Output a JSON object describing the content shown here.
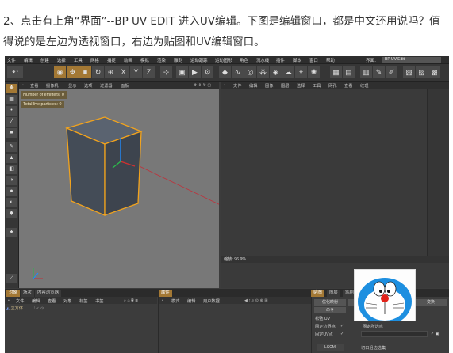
{
  "intro": {
    "line1": "2、点击有上角“界面”--BP UV EDIT 进入UV编辑。下图是编辑窗口，都是中文还用说吗？值",
    "line2": "得说的是左边为透视窗口，右边为贴图和UV编辑窗口。"
  },
  "app": {
    "menu": [
      "文件",
      "编辑",
      "创建",
      "选择",
      "工具",
      "网格",
      "捕捉",
      "动画",
      "模拟",
      "渲染",
      "雕刻",
      "运动跟踪",
      "运动图形",
      "角色",
      "流水线",
      "插件",
      "脚本",
      "窗口",
      "帮助"
    ],
    "layout_label": "界面：",
    "layout_value": "BP UV Edit",
    "viewport": {
      "menu": [
        "查看",
        "摄像机",
        "显示",
        "选项",
        "过滤器",
        "面板"
      ],
      "hud_emitters": "Number of emitters: 0",
      "hud_particles": "Total live particles: 0"
    },
    "uv_editor": {
      "menu": [
        "文件",
        "编辑",
        "图像",
        "图层",
        "选择",
        "工具",
        "网孔",
        "查看",
        "纹理"
      ],
      "zoom": "缩放: 96.9%"
    },
    "objects_panel": {
      "tabs": [
        "对象",
        "场次",
        "内容浏览器"
      ],
      "menu": [
        "文件",
        "编辑",
        "查看",
        "对象",
        "标签",
        "书签"
      ],
      "object_name": "立方体"
    },
    "attributes_panel": {
      "tab": "属性",
      "menu": [
        "模式",
        "编辑",
        "用户数据"
      ]
    },
    "paint_panel": {
      "tabs": [
        "贴图",
        "图层",
        "笔刷"
      ],
      "buttons": [
        "优化映射",
        "重新校准",
        "变换",
        "命令"
      ],
      "section": "松弛 UV",
      "check1": "固定边界点",
      "check2": "固定所选点",
      "check3": "固定UV点",
      "check4": "固定所选点",
      "mode": "LSCM",
      "check5": "切口沿边选集"
    },
    "colors": {
      "accent": "#a37834",
      "bg": "#3c3c3c",
      "cube_edge": "#f2a31d"
    },
    "icons": [
      "undo-icon",
      "move-icon",
      "scale-icon",
      "rotate-icon",
      "cube-icon",
      "render-icon",
      "camera-icon",
      "light-icon"
    ]
  }
}
